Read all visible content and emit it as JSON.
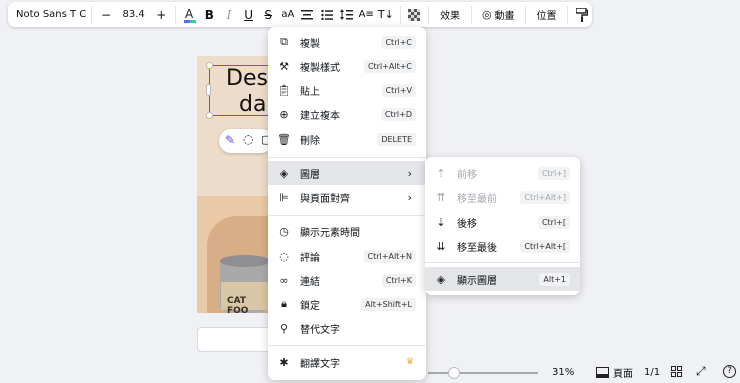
{
  "toolbar": {
    "font_name": "Noto Sans T Chin...",
    "decrease": "−",
    "font_size": "83.4",
    "increase": "+",
    "case": "aA",
    "effects": "效果",
    "animate": "動畫",
    "position": "位置"
  },
  "canvas": {
    "headline_line1": "Desi",
    "headline_line2": "dai",
    "can_text": "CAT FOO"
  },
  "context_menu": {
    "items": [
      {
        "label": "複製",
        "shortcut": "Ctrl+C",
        "icon": "copy-icon"
      },
      {
        "label": "複製樣式",
        "shortcut": "Ctrl+Alt+C",
        "icon": "paint-roller-icon"
      },
      {
        "label": "貼上",
        "shortcut": "Ctrl+V",
        "icon": "clipboard-icon"
      },
      {
        "label": "建立複本",
        "shortcut": "Ctrl+D",
        "icon": "duplicate-icon"
      },
      {
        "label": "刪除",
        "shortcut": "DELETE",
        "icon": "trash-icon"
      },
      {
        "label": "圖層",
        "icon": "layers-icon"
      },
      {
        "label": "與頁面對齊",
        "icon": "align-icon"
      },
      {
        "label": "顯示元素時間",
        "icon": "clock-icon"
      },
      {
        "label": "評論",
        "shortcut": "Ctrl+Alt+N",
        "icon": "comment-icon"
      },
      {
        "label": "連結",
        "shortcut": "Ctrl+K",
        "icon": "link-icon"
      },
      {
        "label": "鎖定",
        "shortcut": "Alt+Shift+L",
        "icon": "lock-icon"
      },
      {
        "label": "替代文字",
        "icon": "accessibility-icon"
      },
      {
        "label": "翻譯文字",
        "icon": "translate-icon"
      }
    ]
  },
  "submenu": {
    "items": [
      {
        "label": "前移",
        "shortcut": "Ctrl+]",
        "disabled": true
      },
      {
        "label": "移至最前",
        "shortcut": "Ctrl+Alt+]",
        "disabled": true
      },
      {
        "label": "後移",
        "shortcut": "Ctrl+["
      },
      {
        "label": "移至最後",
        "shortcut": "Ctrl+Alt+["
      },
      {
        "label": "顯示圖層",
        "shortcut": "Alt+1"
      }
    ]
  },
  "bottom": {
    "zoom": "31%",
    "pages_label": "頁面",
    "page_count": "1/1"
  },
  "colors": {
    "accent": "#8b3dff",
    "hover_bg": "#e3e5e9"
  }
}
